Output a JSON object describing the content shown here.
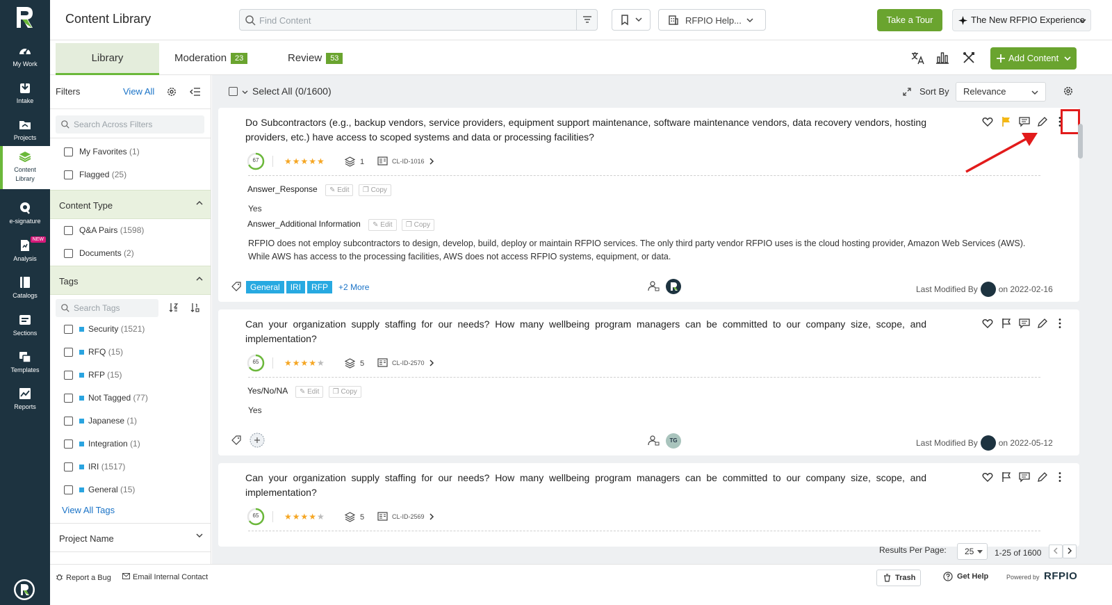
{
  "app": {
    "page_title": "Content Library",
    "colors": {
      "nav_bg": "#1d3340",
      "accent_green": "#6aa42f",
      "tag_blue": "#27a9e1",
      "link_blue": "#1a73c7",
      "annotation_red": "#e21b1b"
    }
  },
  "nav": {
    "items": [
      {
        "label": "My Work",
        "icon": "dashboard-icon"
      },
      {
        "label": "Intake",
        "icon": "intake-icon"
      },
      {
        "label": "Projects",
        "icon": "folder-icon"
      },
      {
        "label": "Content Library",
        "icon": "layers-icon",
        "active": true
      },
      {
        "label": "e-signature",
        "icon": "signature-icon"
      },
      {
        "label": "Analysis",
        "icon": "analysis-icon",
        "badge": "NEW"
      },
      {
        "label": "Catalogs",
        "icon": "book-icon"
      },
      {
        "label": "Sections",
        "icon": "sections-icon"
      },
      {
        "label": "Templates",
        "icon": "templates-icon"
      },
      {
        "label": "Reports",
        "icon": "chart-icon"
      }
    ]
  },
  "header": {
    "search_placeholder": "Find Content",
    "help_label": "RFPIO Help...",
    "tour_label": "Take a Tour",
    "experience_label": "The New RFPIO Experience"
  },
  "tabs": [
    {
      "label": "Library",
      "active": true
    },
    {
      "label": "Moderation",
      "count": "23"
    },
    {
      "label": "Review",
      "count": "53"
    }
  ],
  "toolbar": {
    "add_content_label": "Add Content"
  },
  "filters": {
    "title": "Filters",
    "view_all": "View All",
    "search_placeholder": "Search Across Filters",
    "quick": [
      {
        "label": "My Favorites",
        "count": "(1)"
      },
      {
        "label": "Flagged",
        "count": "(25)"
      }
    ],
    "content_type": {
      "title": "Content Type",
      "items": [
        {
          "label": "Q&A Pairs",
          "count": "(1598)"
        },
        {
          "label": "Documents",
          "count": "(2)"
        }
      ]
    },
    "tags": {
      "title": "Tags",
      "search_placeholder": "Search Tags",
      "items": [
        {
          "label": "Security",
          "count": "(1521)"
        },
        {
          "label": "RFQ",
          "count": "(15)"
        },
        {
          "label": "RFP",
          "count": "(15)"
        },
        {
          "label": "Not Tagged",
          "count": "(77)"
        },
        {
          "label": "Japanese",
          "count": "(1)"
        },
        {
          "label": "Integration",
          "count": "(1)"
        },
        {
          "label": "IRI",
          "count": "(1517)"
        },
        {
          "label": "General",
          "count": "(15)"
        }
      ],
      "view_all": "View All Tags"
    },
    "project_name": "Project Name"
  },
  "list": {
    "select_all": "Select All (0/1600)",
    "sort_by_label": "Sort By",
    "sort_value": "Relevance",
    "cards": [
      {
        "question": "Do Subcontractors (e.g., backup vendors, service providers, equipment support maintenance, software maintenance vendors, data recovery vendors, hosting providers, etc.) have access to scoped systems and data or processing facilities?",
        "score": "67",
        "rating": 5,
        "versions": "1",
        "id": "CL-ID-1016",
        "field1": "Answer_Response",
        "answer1": "Yes",
        "field2": "Answer_Additional Information",
        "answer2": "RFPIO does not employ subcontractors to design, develop, build, deploy or maintain RFPIO services. The only third party vendor RFPIO uses is the cloud hosting provider, Amazon Web Services (AWS). While AWS has access to the processing facilities, AWS does not access RFPIO systems, equipment, or data.",
        "tags": [
          "General",
          "IRI",
          "RFP"
        ],
        "more_tags": "+2 More",
        "last_modified_label": "Last Modified By",
        "last_modified_date": "on 2022-02-16"
      },
      {
        "question": "Can your organization supply staffing for our needs? How many wellbeing program managers can be committed to our company size, scope, and implementation?",
        "score": "65",
        "rating": 4,
        "versions": "5",
        "id": "CL-ID-2570",
        "field1": "Yes/No/NA",
        "answer1": "Yes",
        "owner_initials": "TG",
        "last_modified_label": "Last Modified By",
        "last_modified_date": "on 2022-05-12"
      },
      {
        "question": "Can your organization supply staffing for our needs? How many wellbeing program managers can be committed to our company size, scope, and implementation?",
        "score": "65",
        "rating": 4,
        "versions": "5",
        "id": "CL-ID-2569"
      }
    ],
    "edit_label": "Edit",
    "copy_label": "Copy"
  },
  "pagination": {
    "results_per_page_label": "Results Per Page:",
    "per_page": "25",
    "range": "1-25 of 1600"
  },
  "footer": {
    "report_bug": "Report a Bug",
    "email_contact": "Email Internal Contact",
    "trash": "Trash",
    "get_help": "Get Help",
    "powered_by": "Powered by",
    "brand": "RFPIO"
  }
}
